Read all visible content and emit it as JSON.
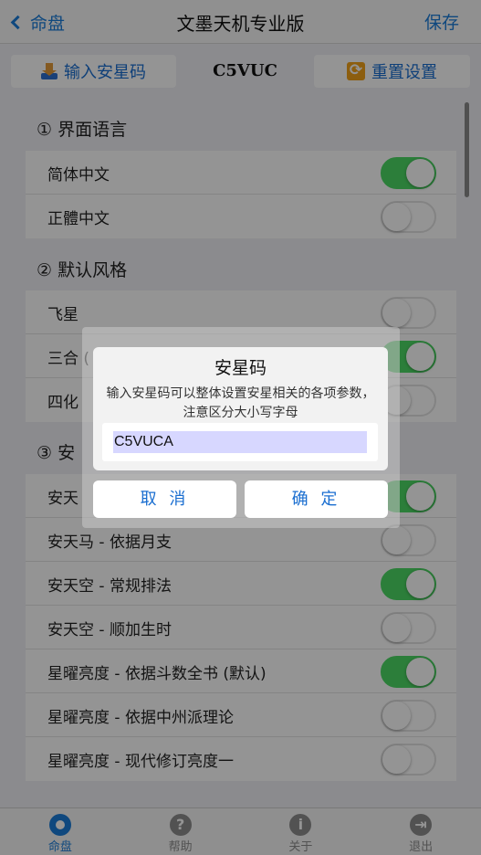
{
  "nav": {
    "back_label": "命盘",
    "title": "文墨天机专业版",
    "save_label": "保存"
  },
  "toolbar": {
    "import_label": "输入安星码",
    "code": "C5VUC",
    "reset_label": "重置设置"
  },
  "sections": [
    {
      "title": "① 界面语言",
      "rows": [
        {
          "label": "简体中文",
          "on": true
        },
        {
          "label": "正體中文",
          "on": false
        }
      ]
    },
    {
      "title": "② 默认风格",
      "rows": [
        {
          "label": "飞星",
          "on": false
        },
        {
          "label": "三合 (",
          "on": true
        },
        {
          "label": "四化",
          "on": false
        }
      ]
    },
    {
      "title": "③ 安",
      "rows": [
        {
          "label": "安天",
          "on": true
        },
        {
          "label": "安天马 - 依据月支",
          "on": false
        },
        {
          "label": "安天空 - 常规排法",
          "on": true
        },
        {
          "label": "安天空 - 顺加生时",
          "on": false
        },
        {
          "label": "星曜亮度 - 依据斗数全书 (默认)",
          "on": true
        },
        {
          "label": "星曜亮度 - 依据中州派理论",
          "on": false
        },
        {
          "label": "星曜亮度 - 现代修订亮度一",
          "on": false
        }
      ]
    }
  ],
  "tabs": [
    {
      "label": "命盘",
      "icon": "chart-icon",
      "active": true,
      "glyph": ""
    },
    {
      "label": "帮助",
      "icon": "help-icon",
      "active": false,
      "glyph": "?"
    },
    {
      "label": "关于",
      "icon": "info-icon",
      "active": false,
      "glyph": "i"
    },
    {
      "label": "退出",
      "icon": "exit-icon",
      "active": false,
      "glyph": "⇥"
    }
  ],
  "dialog": {
    "title": "安星码",
    "message": "输入安星码可以整体设置安星相关的各项参数，注意区分大小写字母",
    "input_value": "C5VUCA",
    "cancel_label": "取 消",
    "ok_label": "确 定"
  },
  "colors": {
    "accent": "#1a7cd9",
    "switch_on": "#4cd964"
  }
}
